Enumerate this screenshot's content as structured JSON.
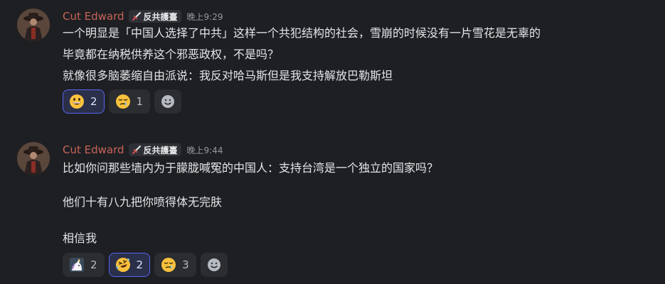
{
  "messages": [
    {
      "username": "Cut Edward",
      "tag": "反共護臺",
      "time": "晚上9:29",
      "lines": [
        "一个明显是「中国人选择了中共」这样一个共犯结构的社会，雪崩的时候没有一片雪花是无辜的",
        "毕竟都在纳税供养这个邪恶政权，不是吗？",
        "就像很多脑萎缩自由派说：我反对哈马斯但是我支持解放巴勒斯坦"
      ],
      "reactions": [
        {
          "emoji": "grinning-face-icon",
          "count": "2",
          "active": true
        },
        {
          "emoji": "sleepy-face-icon",
          "count": "1",
          "active": false
        }
      ]
    },
    {
      "username": "Cut Edward",
      "tag": "反共護臺",
      "time": "晚上9:44",
      "lines": [
        "比如你问那些墙内为于朦胧喊冤的中国人：支持台湾是一个独立的国家吗？",
        "他们十有八九把你喷得体无完肤",
        "相信我"
      ],
      "reactions": [
        {
          "emoji": "unicorn-custom-icon",
          "count": "2",
          "active": false
        },
        {
          "emoji": "rofl-face-icon",
          "count": "2",
          "active": true
        },
        {
          "emoji": "sleepy-face-icon",
          "count": "3",
          "active": false
        }
      ]
    }
  ]
}
